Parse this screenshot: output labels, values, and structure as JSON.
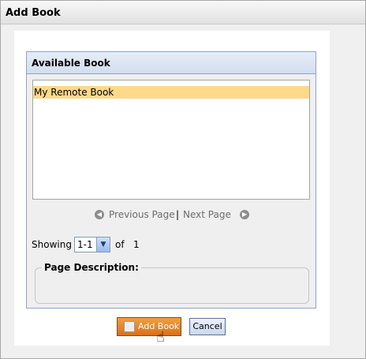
{
  "window": {
    "title": "Add Book"
  },
  "panel": {
    "title": "Available Book",
    "list_items": [
      {
        "label": "My Remote Book",
        "selected": true
      }
    ]
  },
  "pager": {
    "prev_label": "Previous Page",
    "separator": "|",
    "next_label": "Next Page",
    "prev_icon": "arrow-left-circle-icon",
    "next_icon": "arrow-right-circle-icon"
  },
  "paging": {
    "showing_label": "Showing",
    "range_value": "1-1",
    "of_label": "of",
    "total": "1"
  },
  "description": {
    "legend": "Page Description:"
  },
  "buttons": {
    "add_label": "Add Book",
    "cancel_label": "Cancel"
  },
  "colors": {
    "selection": "#ffd98a",
    "add_button": "#e48a2e",
    "panel_header": "#dbe4f2",
    "panel_border": "#8fa5c4"
  }
}
